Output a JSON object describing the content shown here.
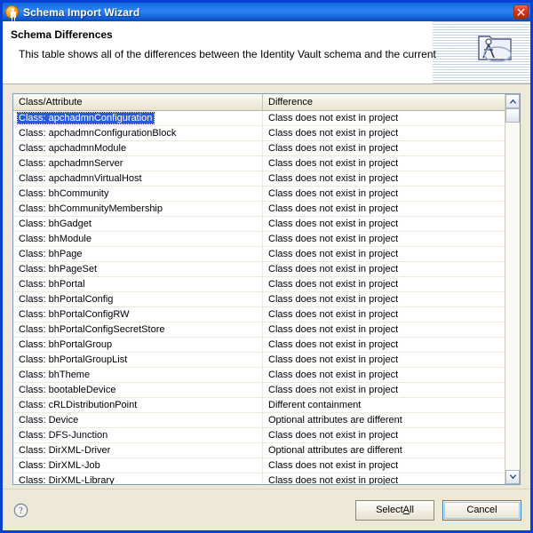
{
  "window": {
    "title": "Schema Import Wizard",
    "app_icon": "wizard-person-icon",
    "close_label": "×",
    "accent_title_color": "#1a74e8",
    "dialog_bg_color": "#ece9d8",
    "selection_color": "#2a5bd7"
  },
  "banner": {
    "title": "Schema Differences",
    "description": "This table shows all of the differences between the Identity Vault schema and the current",
    "icon": "folder-compass-icon"
  },
  "table": {
    "columns": [
      "Class/Attribute",
      "Difference"
    ],
    "rows": [
      {
        "name": "Class: apchadmnConfiguration",
        "difference": "Class does not exist in project",
        "selected": true
      },
      {
        "name": "Class: apchadmnConfigurationBlock",
        "difference": "Class does not exist in project",
        "selected": false
      },
      {
        "name": "Class: apchadmnModule",
        "difference": "Class does not exist in project",
        "selected": false
      },
      {
        "name": "Class: apchadmnServer",
        "difference": "Class does not exist in project",
        "selected": false
      },
      {
        "name": "Class: apchadmnVirtualHost",
        "difference": "Class does not exist in project",
        "selected": false
      },
      {
        "name": "Class: bhCommunity",
        "difference": "Class does not exist in project",
        "selected": false
      },
      {
        "name": "Class: bhCommunityMembership",
        "difference": "Class does not exist in project",
        "selected": false
      },
      {
        "name": "Class: bhGadget",
        "difference": "Class does not exist in project",
        "selected": false
      },
      {
        "name": "Class: bhModule",
        "difference": "Class does not exist in project",
        "selected": false
      },
      {
        "name": "Class: bhPage",
        "difference": "Class does not exist in project",
        "selected": false
      },
      {
        "name": "Class: bhPageSet",
        "difference": "Class does not exist in project",
        "selected": false
      },
      {
        "name": "Class: bhPortal",
        "difference": "Class does not exist in project",
        "selected": false
      },
      {
        "name": "Class: bhPortalConfig",
        "difference": "Class does not exist in project",
        "selected": false
      },
      {
        "name": "Class: bhPortalConfigRW",
        "difference": "Class does not exist in project",
        "selected": false
      },
      {
        "name": "Class: bhPortalConfigSecretStore",
        "difference": "Class does not exist in project",
        "selected": false
      },
      {
        "name": "Class: bhPortalGroup",
        "difference": "Class does not exist in project",
        "selected": false
      },
      {
        "name": "Class: bhPortalGroupList",
        "difference": "Class does not exist in project",
        "selected": false
      },
      {
        "name": "Class: bhTheme",
        "difference": "Class does not exist in project",
        "selected": false
      },
      {
        "name": "Class: bootableDevice",
        "difference": "Class does not exist in project",
        "selected": false
      },
      {
        "name": "Class: cRLDistributionPoint",
        "difference": "Different containment",
        "selected": false
      },
      {
        "name": "Class: Device",
        "difference": "Optional attributes are different",
        "selected": false
      },
      {
        "name": "Class: DFS-Junction",
        "difference": "Class does not exist in project",
        "selected": false
      },
      {
        "name": "Class: DirXML-Driver",
        "difference": "Optional attributes are different",
        "selected": false
      },
      {
        "name": "Class: DirXML-Job",
        "difference": "Class does not exist in project",
        "selected": false
      },
      {
        "name": "Class: DirXML-Library",
        "difference": "Class does not exist in project",
        "selected": false
      }
    ]
  },
  "scrollbar": {
    "up_arrow": "scroll-up-icon",
    "down_arrow": "scroll-down-icon"
  },
  "footer": {
    "help_icon": "help-question-icon",
    "select_all_label": "Select ",
    "select_all_mnemonic": "A",
    "select_all_tail": "ll",
    "cancel_label": "Cancel"
  }
}
